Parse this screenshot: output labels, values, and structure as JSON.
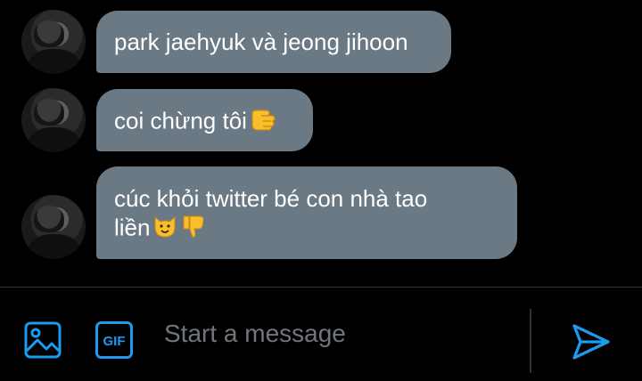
{
  "messages": [
    {
      "lines": [
        "park jaehyuk và jeong jihoon"
      ],
      "emoji": []
    },
    {
      "lines": [
        "coi chừng tôi"
      ],
      "emoji": [
        "backhand-index-pointing-right-emoji"
      ]
    },
    {
      "lines": [
        "cúc khỏi twitter bé con nhà tao",
        "liền"
      ],
      "emoji": [
        "cat-face-emoji",
        "thumbs-down-emoji"
      ]
    }
  ],
  "composer": {
    "image_icon": "image-icon",
    "gif_icon": "gif-icon",
    "gif_label": "GIF",
    "placeholder": "Start a message",
    "value": "",
    "send_icon": "send-icon"
  },
  "colors": {
    "background": "#000000",
    "bubble": "#6b7985",
    "accent": "#1d9bf0",
    "placeholder": "#71767b",
    "divider": "#2f3336"
  }
}
